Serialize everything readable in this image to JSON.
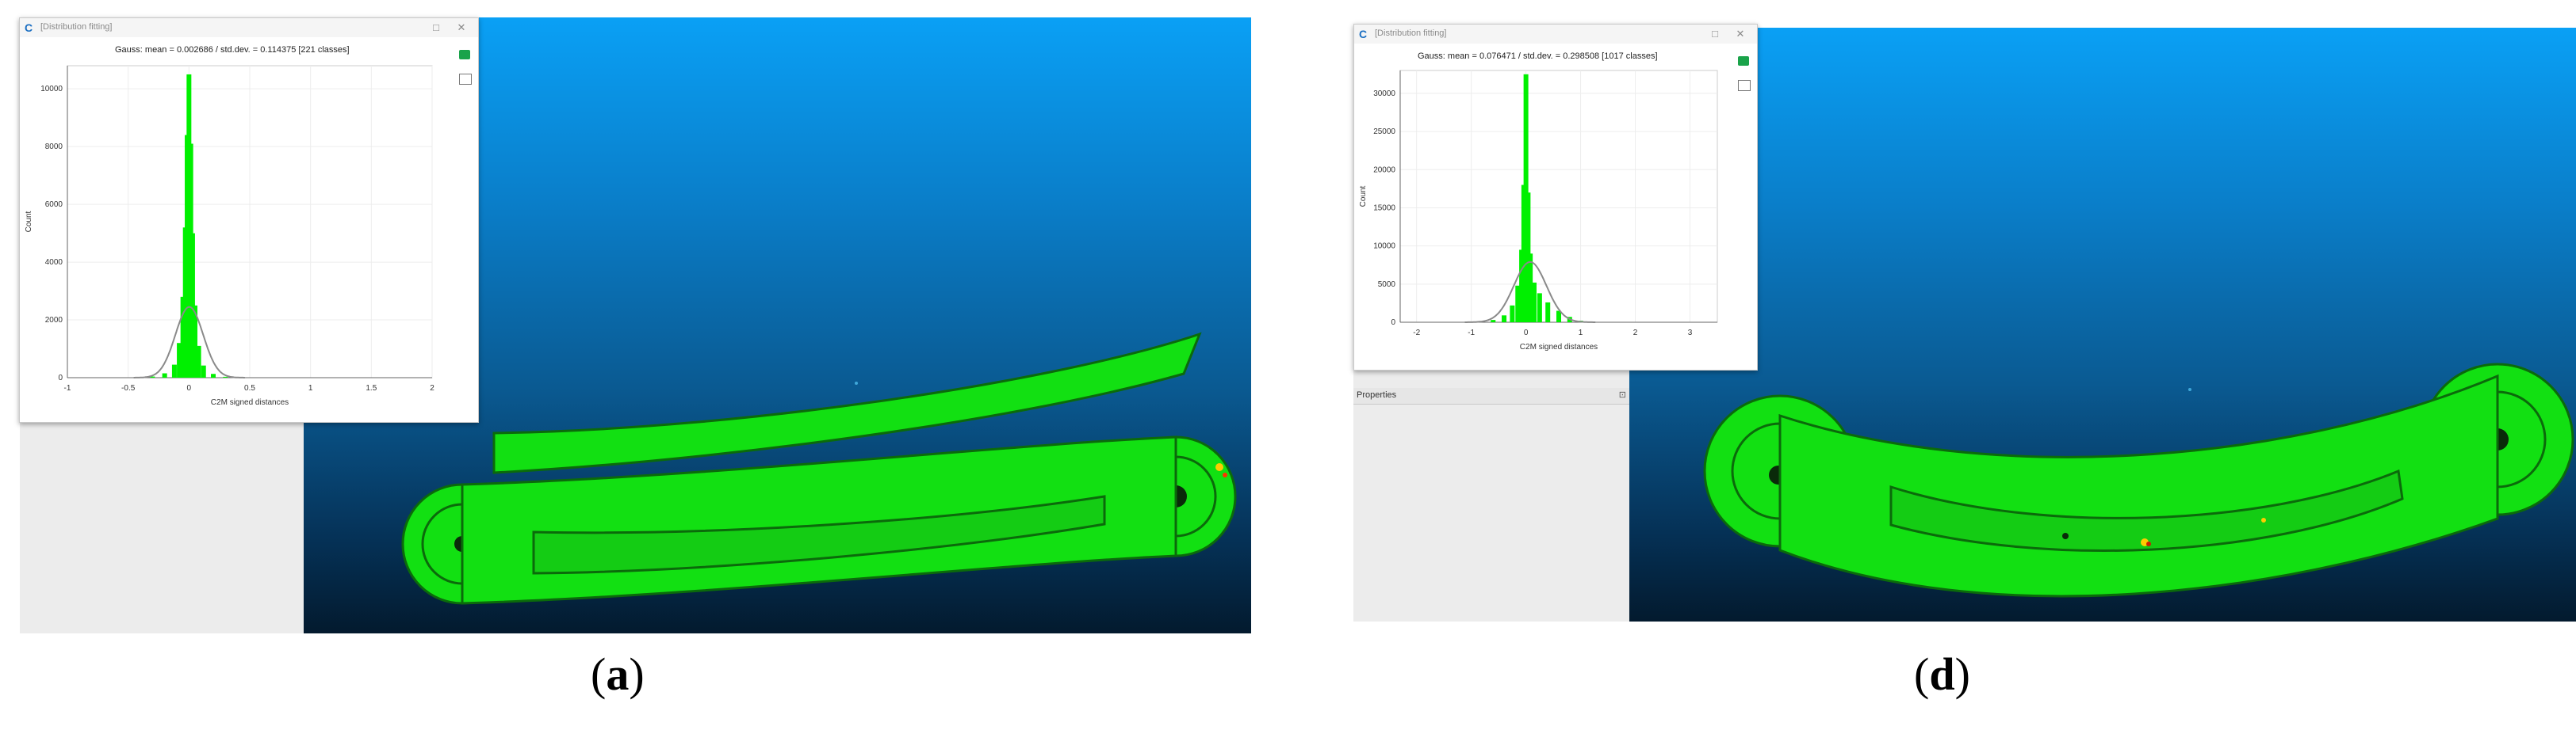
{
  "panels": [
    {
      "dialog": {
        "title": "[Distribution fitting]",
        "stats": "Gauss: mean = 0.002686 / std.dev. = 0.114375 [221 classes]",
        "x_label": "C2M signed distances",
        "y_label": "Count",
        "icons": [
          "app-icon",
          "minimize-icon",
          "close-icon",
          "export-icon",
          "fit-icon"
        ]
      },
      "caption_open": "(",
      "caption_letter": "a",
      "caption_close": ")",
      "chart_data": {
        "type": "bar",
        "x_ticks": [
          "-1",
          "-0.5",
          "0",
          "0.5",
          "1",
          "1.5",
          "2"
        ],
        "y_ticks": [
          "0",
          "2000",
          "4000",
          "6000",
          "8000",
          "10000"
        ],
        "xlim": [
          -1,
          2
        ],
        "ylim": [
          0,
          10800
        ],
        "bar_color": "#00f000",
        "curve_color": "#8a8a8a",
        "x": [
          -0.3,
          -0.2,
          -0.12,
          -0.08,
          -0.05,
          -0.03,
          -0.015,
          0.0,
          0.015,
          0.03,
          0.05,
          0.08,
          0.12,
          0.2,
          0.3
        ],
        "values": [
          40,
          150,
          450,
          1200,
          2800,
          5200,
          8400,
          10500,
          8100,
          5000,
          2500,
          1100,
          420,
          130,
          30
        ],
        "gauss_mean": 0.002686,
        "gauss_std": 0.114375,
        "gauss_peak": 2450
      }
    },
    {
      "dialog": {
        "title": "[Distribution fitting]",
        "stats": "Gauss: mean = 0.076471 / std.dev. = 0.298508 [1017 classes]",
        "x_label": "C2M signed distances",
        "y_label": "Count",
        "icons": [
          "app-icon",
          "minimize-icon",
          "close-icon",
          "export-icon",
          "fit-icon"
        ]
      },
      "properties_label": "Properties",
      "caption_open": "(",
      "caption_letter": "d",
      "caption_close": ")",
      "chart_data": {
        "type": "bar",
        "x_ticks": [
          "-2",
          "-1",
          "0",
          "1",
          "2",
          "3"
        ],
        "y_ticks": [
          "0",
          "5000",
          "10000",
          "15000",
          "20000",
          "25000",
          "30000"
        ],
        "xlim": [
          -2.3,
          3.5
        ],
        "ylim": [
          0,
          33000
        ],
        "bar_color": "#00f000",
        "curve_color": "#8a8a8a",
        "x": [
          -0.6,
          -0.4,
          -0.25,
          -0.15,
          -0.08,
          -0.04,
          0.0,
          0.04,
          0.08,
          0.15,
          0.25,
          0.4,
          0.6,
          0.8,
          1.0
        ],
        "values": [
          300,
          900,
          2200,
          4800,
          9500,
          18000,
          32500,
          17000,
          9000,
          5200,
          3800,
          2600,
          1500,
          700,
          200
        ],
        "gauss_mean": 0.076471,
        "gauss_std": 0.298508,
        "gauss_peak": 7900
      }
    }
  ],
  "colors": {
    "scan_green": "#12e012",
    "viewport_top": "#0aa0f5",
    "viewport_bottom": "#031a2e"
  }
}
